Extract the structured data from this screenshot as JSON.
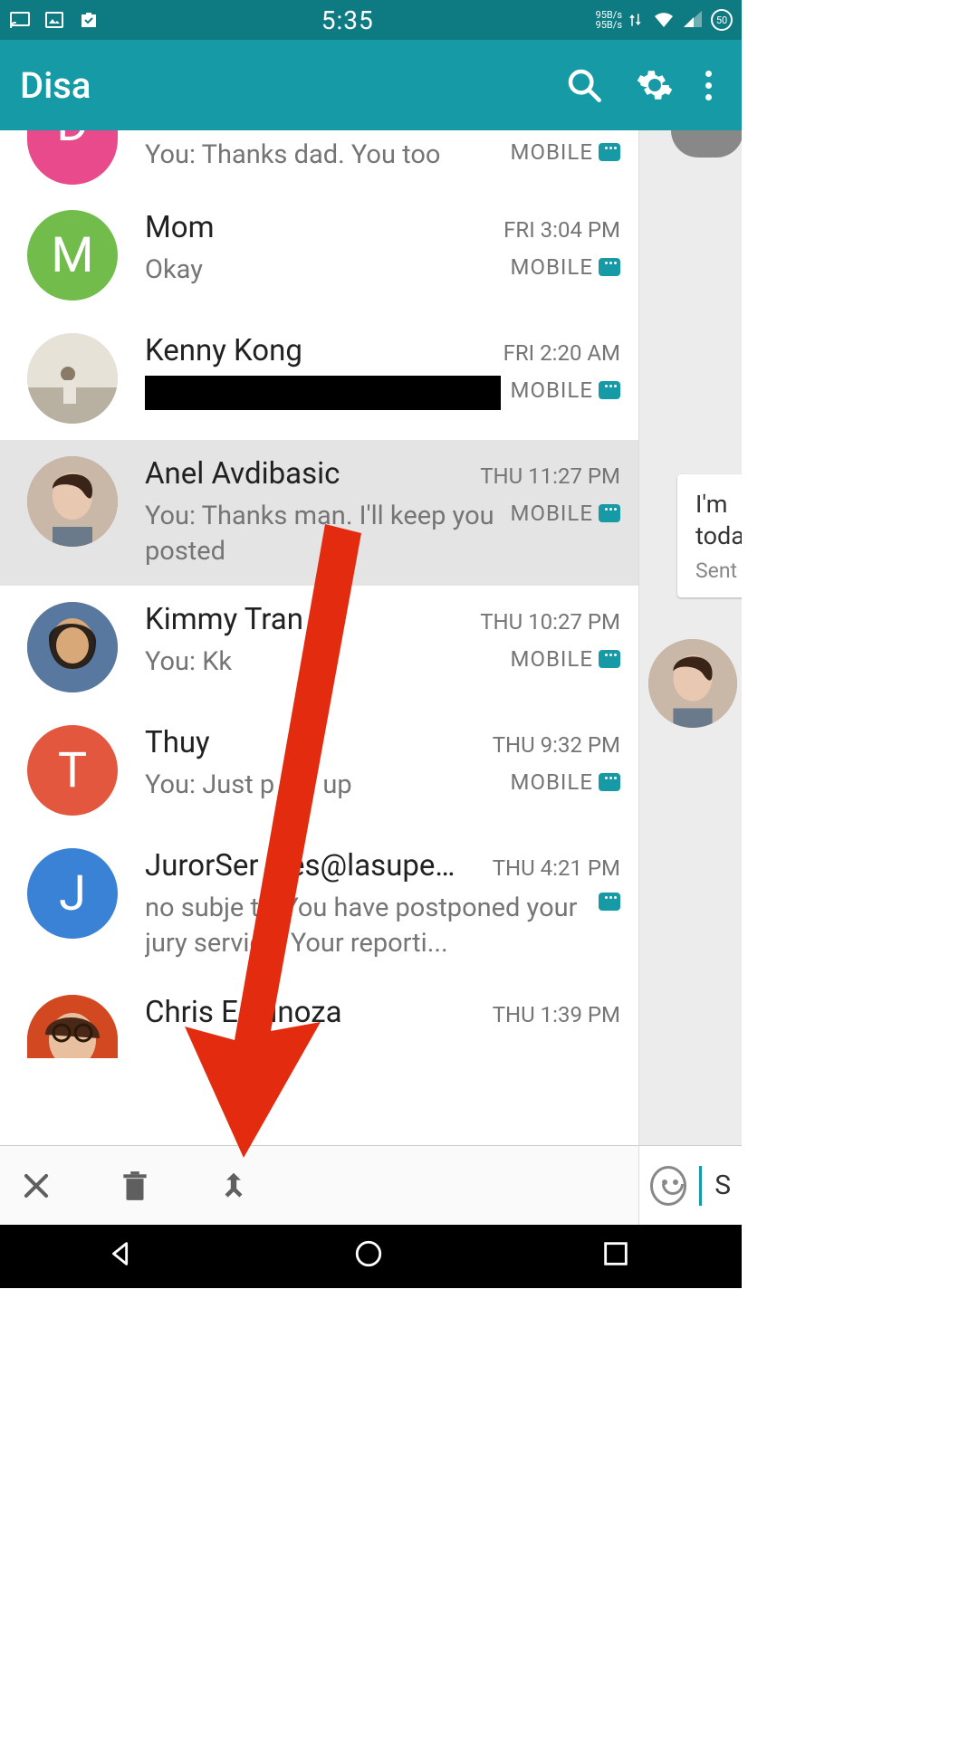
{
  "statusbar": {
    "time": "5:35",
    "net_up": "95B/s",
    "net_down": "95B/s",
    "battery": "50"
  },
  "appbar": {
    "title": "Disa"
  },
  "conversations": [
    {
      "name": "D",
      "preview": "You: Thanks dad. You too",
      "time": "",
      "tag": "MOBILE",
      "avatar_color": "#e84a8b",
      "initial": "D",
      "partial": true
    },
    {
      "name": "Mom",
      "preview": "Okay",
      "time": "FRI 3:04 PM",
      "tag": "MOBILE",
      "avatar_color": "#71bc4a",
      "initial": "M"
    },
    {
      "name": "Kenny Kong",
      "preview": "",
      "time": "FRI 2:20 AM",
      "tag": "MOBILE",
      "avatar_photo": "kenny",
      "redacted": true
    },
    {
      "name": "Anel Avdibasic",
      "preview": "You: Thanks man. I'll keep you posted",
      "time": "THU 11:27 PM",
      "tag": "MOBILE",
      "avatar_photo": "anel",
      "selected": true
    },
    {
      "name": "Kimmy Tran",
      "preview": "You: Kk",
      "time": "THU 10:27 PM",
      "tag": "MOBILE",
      "avatar_photo": "kimmy"
    },
    {
      "name": "Thuy",
      "preview": "You: Just p  led up",
      "time": "THU 9:32 PM",
      "tag": "MOBILE",
      "avatar_color": "#e2573e",
      "initial": "T"
    },
    {
      "name": "JurorSer  ices@lasupe…",
      "preview": " no subje t / You have postponed your jury service. Your reporti...",
      "time": "THU 4:21 PM",
      "tag": "",
      "avatar_color": "#3a82d6",
      "initial": "J",
      "two_line": true
    },
    {
      "name": "Chris     Espinoza",
      "preview": "",
      "time": "THU 1:39 PM",
      "tag": "",
      "avatar_photo": "chris",
      "bottom_cut": true
    }
  ],
  "peek": {
    "bubble_line1": "I'm",
    "bubble_line2": "toda",
    "status": "Sent",
    "input_char": "S"
  }
}
